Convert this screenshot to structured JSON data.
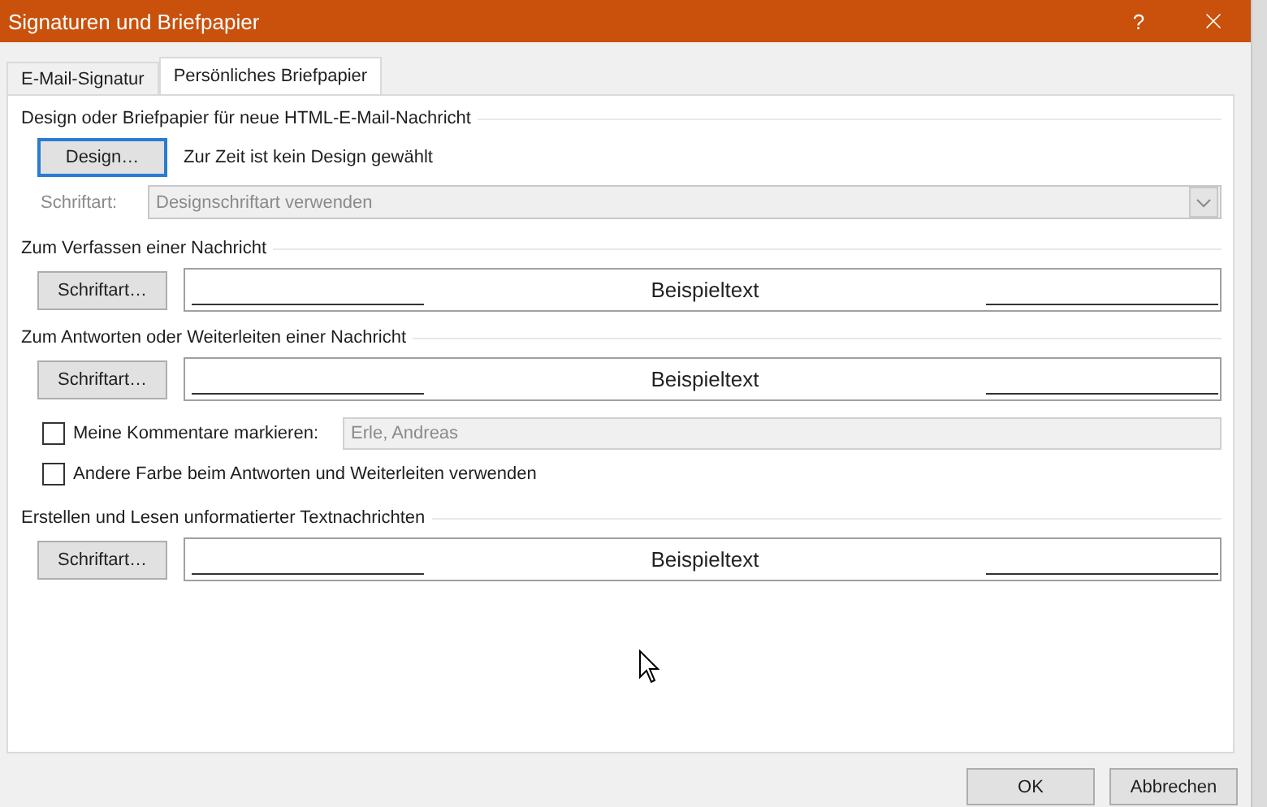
{
  "window": {
    "title": "Signaturen und Briefpapier",
    "help": "?"
  },
  "tabs": [
    {
      "label": "E-Mail-Signatur",
      "selected": false
    },
    {
      "label": "Persönliches Briefpapier",
      "selected": true
    }
  ],
  "design": {
    "heading": "Design oder Briefpapier für neue HTML-E-Mail-Nachricht",
    "button": "Design…",
    "status": "Zur Zeit ist kein Design gewählt",
    "font_label": "Schriftart:",
    "font_value": "Designschriftart verwenden",
    "disabled": true
  },
  "compose": {
    "heading": "Zum Verfassen einer Nachricht",
    "button": "Schriftart…",
    "preview": "Beispieltext"
  },
  "reply": {
    "heading": "Zum Antworten oder Weiterleiten einer Nachricht",
    "button": "Schriftart…",
    "preview": "Beispieltext"
  },
  "options": [
    {
      "kind": "checkbox-field",
      "label": "Meine Kommentare markieren:",
      "checked": false,
      "value": "Erle, Andreas",
      "disabled": true
    },
    {
      "kind": "checkbox",
      "label": "Andere Farbe beim Antworten und Weiterleiten verwenden",
      "checked": false
    }
  ],
  "plain": {
    "heading": "Erstellen und Lesen unformatierter Textnachrichten",
    "button": "Schriftart…",
    "preview": "Beispieltext"
  },
  "buttons": [
    {
      "label": "OK"
    },
    {
      "label": "Abbrechen"
    }
  ]
}
